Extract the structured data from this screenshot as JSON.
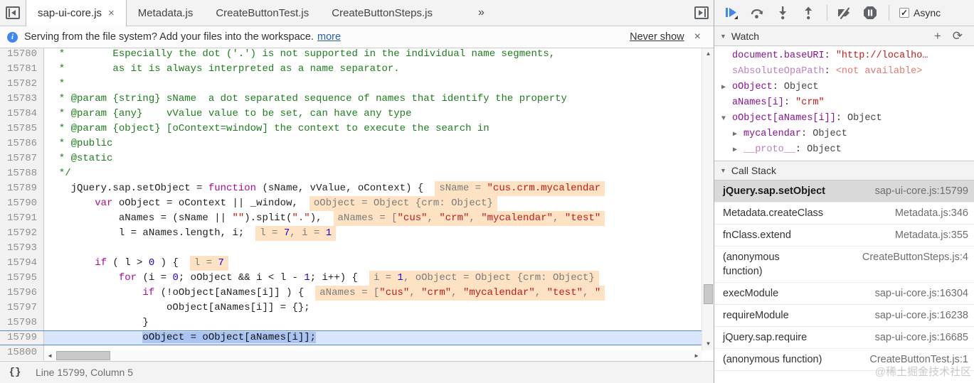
{
  "tabbar": {
    "tabs": [
      {
        "label": "sap-ui-core.js",
        "active": true,
        "closable": true
      },
      {
        "label": "Metadata.js",
        "active": false,
        "closable": false
      },
      {
        "label": "CreateButtonTest.js",
        "active": false,
        "closable": false
      },
      {
        "label": "CreateButtonSteps.js",
        "active": false,
        "closable": false
      }
    ],
    "close_label": "×",
    "overflow": "»"
  },
  "infobar": {
    "message": "Serving from the file system? Add your files into the workspace.",
    "more_label": "more",
    "never_show_label": "Never show",
    "close_label": "×"
  },
  "editor": {
    "lines": [
      {
        "num": 15780,
        "tokens": [
          {
            "c": "c",
            "s": "  *        Especially the dot ('.') is not supported in the individual name segments,"
          }
        ]
      },
      {
        "num": 15781,
        "tokens": [
          {
            "c": "c",
            "s": "  *        as it is always interpreted as a name separator."
          }
        ]
      },
      {
        "num": 15782,
        "tokens": [
          {
            "c": "c",
            "s": "  *"
          }
        ]
      },
      {
        "num": 15783,
        "tokens": [
          {
            "c": "c",
            "s": "  * @param {string} sName  a dot separated sequence of names that identify the property"
          }
        ]
      },
      {
        "num": 15784,
        "tokens": [
          {
            "c": "c",
            "s": "  * @param {any}    vValue value to be set, can have any type"
          }
        ]
      },
      {
        "num": 15785,
        "tokens": [
          {
            "c": "c",
            "s": "  * @param {object} [oContext=window] the context to execute the search in"
          }
        ]
      },
      {
        "num": 15786,
        "tokens": [
          {
            "c": "c",
            "s": "  * @public"
          }
        ]
      },
      {
        "num": 15787,
        "tokens": [
          {
            "c": "c",
            "s": "  * @static"
          }
        ]
      },
      {
        "num": 15788,
        "tokens": [
          {
            "c": "c",
            "s": "  */"
          }
        ]
      },
      {
        "num": 15789,
        "tokens": [
          {
            "c": "p",
            "s": "    jQuery.sap.setObject = "
          },
          {
            "c": "k",
            "s": "function"
          },
          {
            "c": "p",
            "s": " (sName, vValue, oContext) {"
          }
        ],
        "badge": [
          {
            "c": "bn",
            "s": "sName = "
          },
          {
            "c": "bs",
            "s": "\"cus.crm.mycalendar"
          }
        ]
      },
      {
        "num": 15790,
        "tokens": [
          {
            "c": "p",
            "s": "        "
          },
          {
            "c": "k",
            "s": "var"
          },
          {
            "c": "p",
            "s": " oObject = oContext || _window,"
          }
        ],
        "badge": [
          {
            "c": "bn",
            "s": "oObject = Object {crm: Object}"
          }
        ]
      },
      {
        "num": 15791,
        "tokens": [
          {
            "c": "p",
            "s": "            aNames = (sName || "
          },
          {
            "c": "s",
            "s": "\"\""
          },
          {
            "c": "p",
            "s": ").split("
          },
          {
            "c": "s",
            "s": "\".\""
          },
          {
            "c": "p",
            "s": "),"
          }
        ],
        "badge": [
          {
            "c": "bn",
            "s": "aNames = ["
          },
          {
            "c": "bs",
            "s": "\"cus\""
          },
          {
            "c": "bn",
            "s": ", "
          },
          {
            "c": "bs",
            "s": "\"crm\""
          },
          {
            "c": "bn",
            "s": ", "
          },
          {
            "c": "bs",
            "s": "\"mycalendar\""
          },
          {
            "c": "bn",
            "s": ", "
          },
          {
            "c": "bs",
            "s": "\"test\""
          }
        ]
      },
      {
        "num": 15792,
        "tokens": [
          {
            "c": "p",
            "s": "            l = aNames.length, i;"
          }
        ],
        "badge": [
          {
            "c": "bn",
            "s": "l = "
          },
          {
            "c": "bnum",
            "s": "7"
          },
          {
            "c": "bn",
            "s": ", i = "
          },
          {
            "c": "bnum",
            "s": "1"
          }
        ]
      },
      {
        "num": 15793,
        "tokens": []
      },
      {
        "num": 15794,
        "tokens": [
          {
            "c": "p",
            "s": "        "
          },
          {
            "c": "k",
            "s": "if"
          },
          {
            "c": "p",
            "s": " ( l > "
          },
          {
            "c": "n",
            "s": "0"
          },
          {
            "c": "p",
            "s": " ) {"
          }
        ],
        "badge": [
          {
            "c": "bn",
            "s": "l = "
          },
          {
            "c": "bnum",
            "s": "7"
          }
        ]
      },
      {
        "num": 15795,
        "tokens": [
          {
            "c": "p",
            "s": "            "
          },
          {
            "c": "k",
            "s": "for"
          },
          {
            "c": "p",
            "s": " (i = "
          },
          {
            "c": "n",
            "s": "0"
          },
          {
            "c": "p",
            "s": "; oObject && i < l - "
          },
          {
            "c": "n",
            "s": "1"
          },
          {
            "c": "p",
            "s": "; i++) {"
          }
        ],
        "badge": [
          {
            "c": "bn",
            "s": "i = "
          },
          {
            "c": "bnum",
            "s": "1"
          },
          {
            "c": "bn",
            "s": ", oObject = Object {crm: Object}"
          }
        ]
      },
      {
        "num": 15796,
        "tokens": [
          {
            "c": "p",
            "s": "                "
          },
          {
            "c": "k",
            "s": "if"
          },
          {
            "c": "p",
            "s": " (!oObject[aNames[i]] ) {"
          }
        ],
        "badge": [
          {
            "c": "bn",
            "s": "aNames = ["
          },
          {
            "c": "bs",
            "s": "\"cus\""
          },
          {
            "c": "bn",
            "s": ", "
          },
          {
            "c": "bs",
            "s": "\"crm\""
          },
          {
            "c": "bn",
            "s": ", "
          },
          {
            "c": "bs",
            "s": "\"mycalendar\""
          },
          {
            "c": "bn",
            "s": ", "
          },
          {
            "c": "bs",
            "s": "\"test\""
          },
          {
            "c": "bn",
            "s": ", "
          },
          {
            "c": "bs",
            "s": "\""
          }
        ]
      },
      {
        "num": 15797,
        "tokens": [
          {
            "c": "p",
            "s": "                    oObject[aNames[i]] = {};"
          }
        ]
      },
      {
        "num": 15798,
        "tokens": [
          {
            "c": "p",
            "s": "                }"
          }
        ]
      },
      {
        "num": 15799,
        "current": true,
        "tokens": [
          {
            "c": "p",
            "s": "                "
          },
          {
            "c": "exec",
            "s": "oObject = oObject[aNames[i]];"
          }
        ]
      },
      {
        "num": 15800,
        "tokens": []
      }
    ]
  },
  "statusbar": {
    "pretty_print_label": "{}",
    "line_info": "Line 15799, Column 5"
  },
  "debugger_toolbar": {
    "buttons": [
      "resume",
      "step-over",
      "step-into",
      "step-out",
      "deactivate-breakpoints",
      "pause-on-exceptions"
    ],
    "async_label": "Async",
    "async_checked": true
  },
  "watch": {
    "title": "Watch",
    "add_label": "+",
    "refresh_label": "⟳",
    "items": [
      {
        "arrow": "",
        "indent": 0,
        "name": "document.baseURI",
        "dim": false,
        "value": "\"http://localho…",
        "vtype": "string"
      },
      {
        "arrow": "",
        "indent": 0,
        "name": "sAbsoluteOpaPath",
        "dim": true,
        "value": "<not available>",
        "vtype": "na"
      },
      {
        "arrow": "▶",
        "indent": 0,
        "name": "oObject",
        "dim": false,
        "value": "Object",
        "vtype": "obj"
      },
      {
        "arrow": "",
        "indent": 0,
        "name": "aNames[i]",
        "dim": false,
        "value": "\"crm\"",
        "vtype": "string"
      },
      {
        "arrow": "▼",
        "indent": 0,
        "name": "oObject[aNames[i]]",
        "dim": false,
        "value": "Object",
        "vtype": "obj"
      },
      {
        "arrow": "▶",
        "indent": 1,
        "name": "mycalendar",
        "dim": false,
        "value": "Object",
        "vtype": "obj"
      },
      {
        "arrow": "▶",
        "indent": 1,
        "name": "__proto__",
        "dim": true,
        "value": "Object",
        "vtype": "obj"
      }
    ]
  },
  "call_stack": {
    "title": "Call Stack",
    "frames": [
      {
        "fn": "jQuery.sap.setObject",
        "loc": "sap-ui-core.js:15799",
        "selected": true,
        "two_line": false
      },
      {
        "fn": "Metadata.createClass",
        "loc": "Metadata.js:346",
        "selected": false,
        "two_line": false
      },
      {
        "fn": "fnClass.extend",
        "loc": "Metadata.js:355",
        "selected": false,
        "two_line": false
      },
      {
        "fn": "(anonymous function)",
        "loc": "CreateButtonSteps.js:4",
        "selected": false,
        "two_line": true
      },
      {
        "fn": "execModule",
        "loc": "sap-ui-core.js:16304",
        "selected": false,
        "two_line": false
      },
      {
        "fn": "requireModule",
        "loc": "sap-ui-core.js:16238",
        "selected": false,
        "two_line": false
      },
      {
        "fn": "jQuery.sap.require",
        "loc": "sap-ui-core.js:16685",
        "selected": false,
        "two_line": false
      },
      {
        "fn": "(anonymous function)",
        "loc": "CreateButtonTest.js:1",
        "selected": false,
        "two_line": false
      }
    ]
  },
  "watermark": {
    "text": "@稀土掘金技术社区"
  },
  "colors": {
    "accent_blue": "#4285f4",
    "execution_line_bg": "#d9e7fd",
    "execution_statement_bg": "#abc4f2",
    "inline_value_badge_bg": "#fde2c4",
    "syntax_keyword": "#aa0d91",
    "syntax_comment": "#1e7d1e",
    "syntax_string": "#c41a16",
    "syntax_number": "#1c00cf",
    "watch_name_purple": "#881391",
    "selected_frame_bg": "#d9d9d9",
    "chrome_bg": "#f3f3f3"
  }
}
